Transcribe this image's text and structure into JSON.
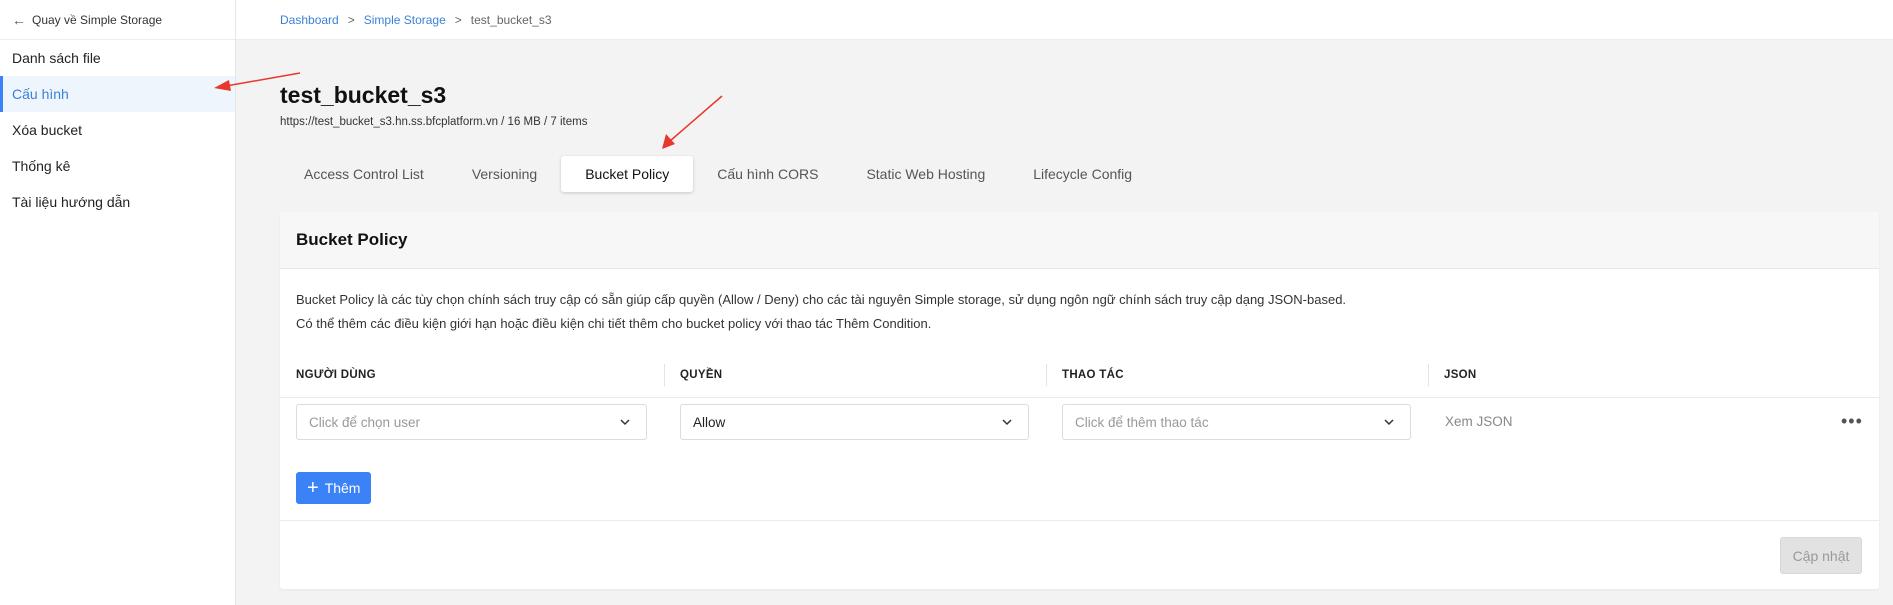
{
  "sidebar": {
    "back_label": "Quay về Simple Storage",
    "items": [
      {
        "label": "Danh sách file"
      },
      {
        "label": "Cấu hình"
      },
      {
        "label": "Xóa bucket"
      },
      {
        "label": "Thống kê"
      },
      {
        "label": "Tài liệu hướng dẫn"
      }
    ],
    "active_index": 1
  },
  "breadcrumb": {
    "items": [
      {
        "label": "Dashboard"
      },
      {
        "label": "Simple Storage"
      },
      {
        "label": "test_bucket_s3"
      }
    ],
    "separator": ">"
  },
  "header": {
    "title": "test_bucket_s3",
    "subtitle": "https://test_bucket_s3.hn.ss.bfcplatform.vn / 16 MB / 7 items"
  },
  "tabs": [
    {
      "label": "Access Control List"
    },
    {
      "label": "Versioning"
    },
    {
      "label": "Bucket Policy"
    },
    {
      "label": "Cấu hình CORS"
    },
    {
      "label": "Static Web Hosting"
    },
    {
      "label": "Lifecycle Config"
    }
  ],
  "active_tab": 2,
  "card": {
    "title": "Bucket Policy",
    "description_lines": [
      "Bucket Policy là các tùy chọn chính sách truy cập có sẵn giúp cấp quyền (Allow / Deny) cho các tài nguyên Simple storage, sử dụng ngôn ngữ chính sách truy cập dạng JSON-based.",
      "Có thể thêm các điều kiện giới hạn hoặc điều kiện chi tiết thêm cho bucket policy với thao tác Thêm Condition."
    ],
    "columns": [
      "NGƯỜI DÙNG",
      "QUYỀN",
      "THAO TÁC",
      "JSON"
    ],
    "row": {
      "user_placeholder": "Click để chọn user",
      "permission_value": "Allow",
      "action_placeholder": "Click để thêm thao tác",
      "json_link": "Xem JSON",
      "more_icon": "more-horizontal-icon"
    },
    "add_button_label": "Thêm",
    "update_button_label": "Cập nhật"
  },
  "colors": {
    "accent": "#3b82f6",
    "annotation": "#e8372c"
  }
}
